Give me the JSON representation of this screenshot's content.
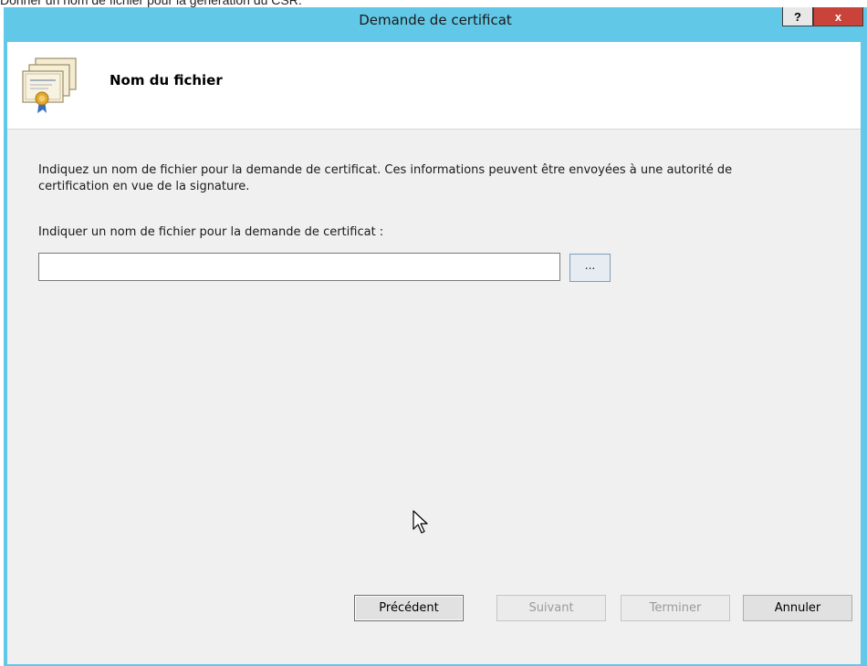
{
  "caption": "Donner un nom de fichier pour la génération du CSR.",
  "window": {
    "title": "Demande de certificat",
    "help_label": "?",
    "close_label": "x"
  },
  "header": {
    "title": "Nom du fichier",
    "icon": "certificate-stack-icon"
  },
  "content": {
    "description": "Indiquez un nom de fichier pour la demande de certificat. Ces informations peuvent être envoyées à une autorité de certification en vue de la signature.",
    "field_label": "Indiquer un nom de fichier pour la demande de certificat :",
    "filename_value": "",
    "browse_label": "..."
  },
  "buttons": {
    "previous": "Précédent",
    "next": "Suivant",
    "finish": "Terminer",
    "cancel": "Annuler"
  },
  "colors": {
    "titlebar": "#62c8e8",
    "close": "#c9433a",
    "client": "#f0f0f0"
  }
}
